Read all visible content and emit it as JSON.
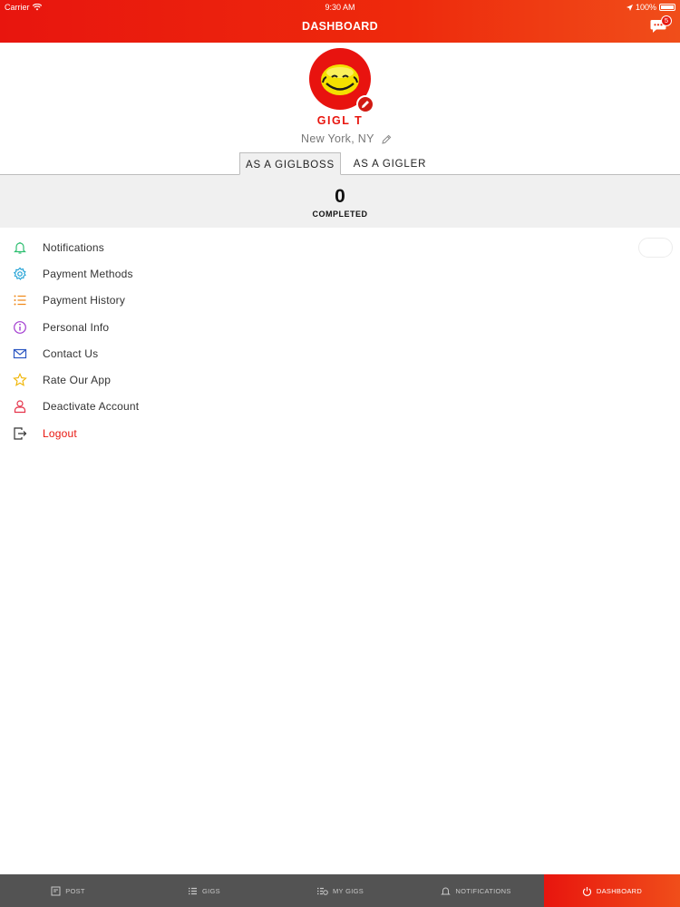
{
  "status_bar": {
    "carrier": "Carrier",
    "time": "9:30 AM",
    "battery": "100%"
  },
  "header": {
    "title": "DASHBOARD",
    "chat_badge": "5"
  },
  "profile": {
    "name": "GIGL  T",
    "location": "New York, NY"
  },
  "tabs": [
    {
      "label": "AS A GIGLBOSS",
      "active": true
    },
    {
      "label": "AS A GIGLER",
      "active": false
    }
  ],
  "stats": {
    "count": "0",
    "label": "COMPLETED"
  },
  "menu": [
    {
      "label": "Notifications",
      "icon": "bell-icon",
      "color": "#2fbf71"
    },
    {
      "label": "Payment Methods",
      "icon": "gear-icon",
      "color": "#1ea0d5"
    },
    {
      "label": "Payment History",
      "icon": "list-icon",
      "color": "#f08a1c"
    },
    {
      "label": "Personal Info",
      "icon": "info-icon",
      "color": "#a23bd0"
    },
    {
      "label": "Contact Us",
      "icon": "mail-icon",
      "color": "#2b56c2"
    },
    {
      "label": "Rate Our App",
      "icon": "star-icon",
      "color": "#f0b400"
    },
    {
      "label": "Deactivate Account",
      "icon": "user-icon",
      "color": "#e5334a"
    },
    {
      "label": "Logout",
      "icon": "logout-icon",
      "color": "#333333"
    }
  ],
  "bottom_tabs": [
    {
      "label": "POST",
      "icon": "post-icon",
      "active": false
    },
    {
      "label": "GIGS",
      "icon": "list-icon",
      "active": false
    },
    {
      "label": "MY GIGS",
      "icon": "my-gigs-icon",
      "active": false
    },
    {
      "label": "NOTIFICATIONS",
      "icon": "bell-icon",
      "active": false
    },
    {
      "label": "DASHBOARD",
      "icon": "power-icon",
      "active": true
    }
  ],
  "colors": {
    "brand": "#e8150e",
    "brand_gradient_end": "#f04e1a",
    "tabbar": "#535353"
  }
}
